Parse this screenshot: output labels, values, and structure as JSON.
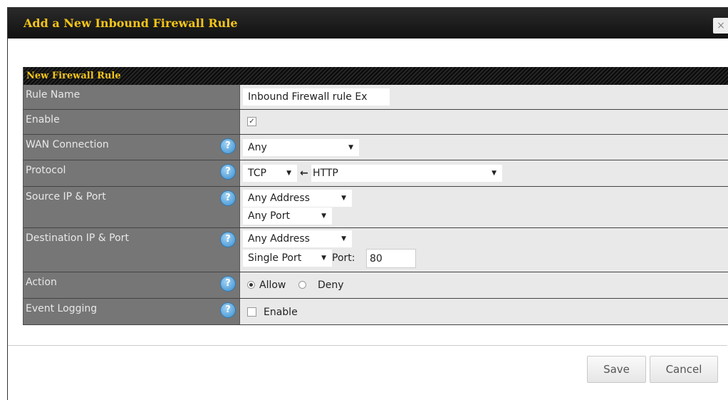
{
  "dialog": {
    "title": "Add a New Inbound Firewall Rule",
    "close_icon": "×"
  },
  "panel": {
    "header": "New Firewall Rule",
    "rows": {
      "rule_name": {
        "label": "Rule Name",
        "value": "Inbound Firewall rule Ex"
      },
      "enable": {
        "label": "Enable",
        "checked": true,
        "check_glyph": "✓"
      },
      "wan": {
        "label": "WAN Connection",
        "value": "Any"
      },
      "protocol": {
        "label": "Protocol",
        "value": "TCP",
        "arrow": "←",
        "service": "HTTP"
      },
      "source": {
        "label": "Source IP & Port",
        "address": "Any Address",
        "port": "Any Port"
      },
      "destination": {
        "label": "Destination IP & Port",
        "address": "Any Address",
        "port_type": "Single Port",
        "port_label": "Port:",
        "port_value": "80"
      },
      "action": {
        "label": "Action",
        "allow": "Allow",
        "deny": "Deny",
        "selected": "Allow"
      },
      "event_logging": {
        "label": "Event Logging",
        "enable_label": "Enable",
        "checked": false
      }
    },
    "help_glyph": "?"
  },
  "buttons": {
    "save": "Save",
    "cancel": "Cancel"
  },
  "select_arrow": "▼"
}
